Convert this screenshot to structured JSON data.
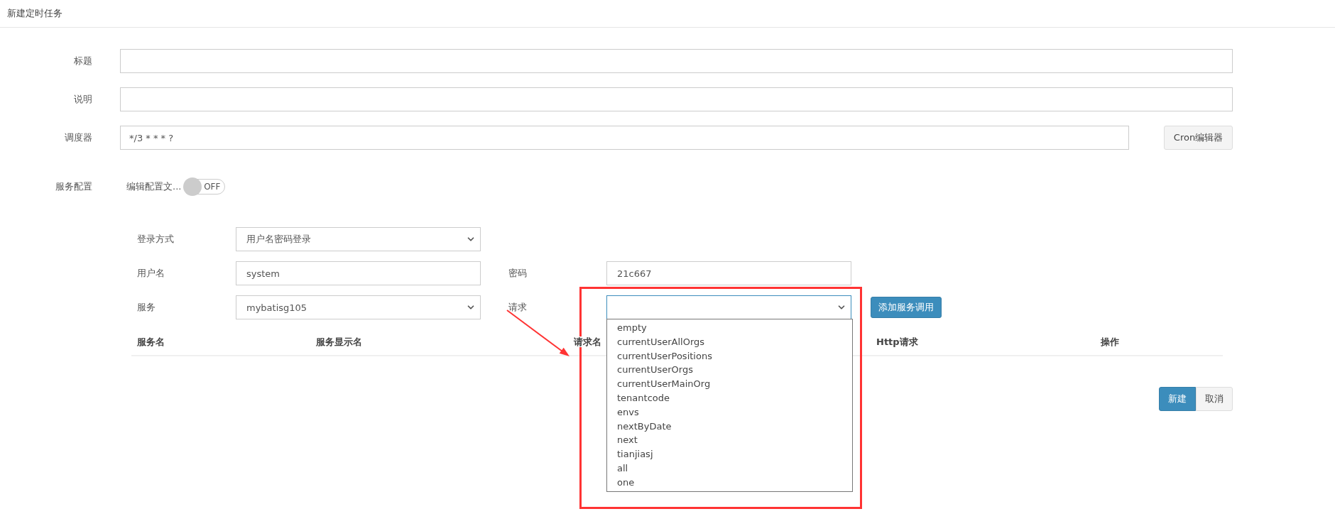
{
  "page_title": "新建定时任务",
  "fields": [
    {
      "label": "标题"
    },
    {
      "label": "说明"
    },
    {
      "label": "调度器",
      "value": "*/3 * * * ?",
      "button": "Cron编辑器"
    }
  ],
  "service_config": {
    "label": "服务配置",
    "toggle_label": "编辑配置文...",
    "toggle_text": "OFF",
    "on": false
  },
  "login_method": {
    "label": "登录方式",
    "value": "用户名密码登录"
  },
  "username": {
    "label": "用户名",
    "value": "system"
  },
  "password": {
    "label": "密码",
    "value": "21c667"
  },
  "service": {
    "label": "服务",
    "value": "mybatisg105"
  },
  "request": {
    "label": "请求",
    "expanded": true,
    "options": [
      "empty",
      "currentUserAllOrgs",
      "currentUserPositions",
      "currentUserOrgs",
      "currentUserMainOrg",
      "tenantcode",
      "envs",
      "nextByDate",
      "next",
      "tianjiasj",
      "all",
      "one"
    ]
  },
  "add_button": "添加服务调用",
  "table": {
    "columns": [
      "服务名",
      "服务显示名",
      "请求名",
      "Http请求",
      "操作"
    ]
  },
  "footer_buttons": [
    {
      "label": "新建",
      "kind": "primary"
    },
    {
      "label": "取消",
      "kind": "default"
    }
  ]
}
